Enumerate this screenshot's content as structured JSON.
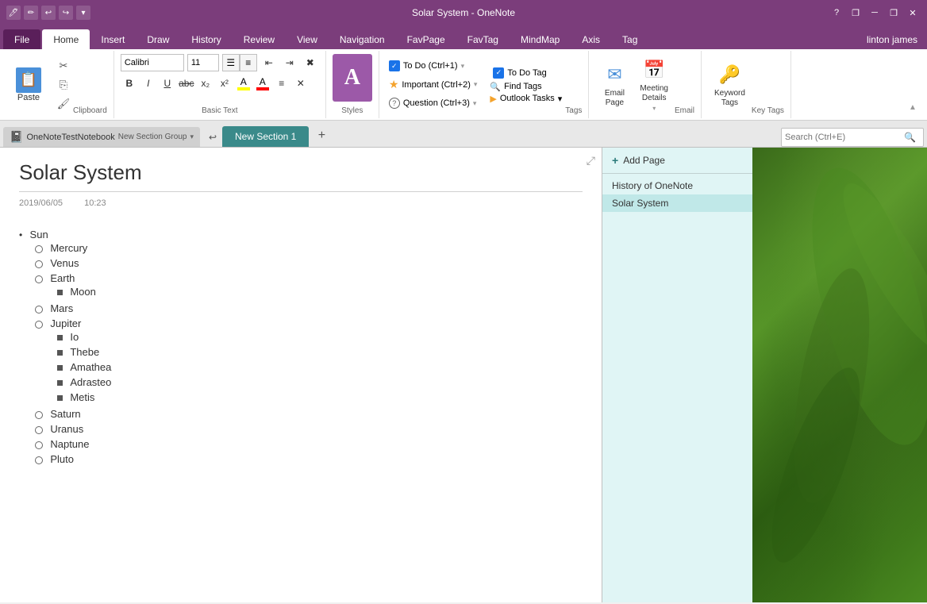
{
  "titlebar": {
    "title": "Solar System - OneNote",
    "help": "?",
    "restore": "❐",
    "minimize": "─",
    "maximize": "❐",
    "close": "✕"
  },
  "ribbon": {
    "tabs": [
      "File",
      "Home",
      "Insert",
      "Draw",
      "History",
      "Review",
      "View",
      "Navigation",
      "FavPage",
      "FavTag",
      "MindMap",
      "Axis",
      "Tag"
    ],
    "active_tab": "Home",
    "user": "linton james",
    "clipboard": {
      "paste": "Paste",
      "cut": "✂",
      "copy": "⎘",
      "format_painter": "🖌"
    },
    "basic_text": {
      "label": "Basic Text",
      "font": "Calibri",
      "size": "11",
      "bold": "B",
      "italic": "I",
      "underline": "U",
      "strikethrough": "ab̶c̶",
      "subscript": "x₂",
      "superscript": "x²"
    },
    "styles": {
      "label": "Styles",
      "icon": "A"
    },
    "tags": {
      "label": "Tags",
      "todo": "To Do (Ctrl+1)",
      "important": "Important (Ctrl+2)",
      "question": "Question (Ctrl+3)",
      "todo_tag": "To Do Tag",
      "find_tags": "Find Tags",
      "outlook_tasks": "Outlook Tasks"
    },
    "email": {
      "label": "Email",
      "email_page": "Email\nPage",
      "meeting_details": "Meeting\nDetails",
      "keyword_tags": "Keyword\nTags"
    }
  },
  "section_bar": {
    "notebook": "OneNoteTestNotebook",
    "section_group": "New Section Group",
    "section": "New Section 1",
    "search_placeholder": "Search (Ctrl+E)"
  },
  "note": {
    "title": "Solar System",
    "date": "2019/06/05",
    "time": "10:23",
    "content": {
      "sun": "Sun",
      "planets": [
        {
          "name": "Mercury",
          "moons": []
        },
        {
          "name": "Venus",
          "moons": []
        },
        {
          "name": "Earth",
          "moons": [
            "Moon"
          ]
        },
        {
          "name": "Mars",
          "moons": []
        },
        {
          "name": "Jupiter",
          "moons": [
            "Io",
            "Thebe",
            "Amathea",
            "Adrasteo",
            "Metis"
          ]
        },
        {
          "name": "Saturn",
          "moons": []
        },
        {
          "name": "Uranus",
          "moons": []
        },
        {
          "name": "Naptune",
          "moons": []
        },
        {
          "name": "Pluto",
          "moons": []
        }
      ]
    }
  },
  "right_panel": {
    "add_page": "Add Page",
    "history_label": "History of OneNote",
    "pages": [
      "Solar System"
    ]
  },
  "icons": {
    "notebook": "📓",
    "paste": "📋",
    "search": "🔍",
    "email": "✉",
    "meeting": "📅",
    "keyword": "🔑",
    "expand": "⤢",
    "plus": "+",
    "undo": "↩",
    "dropdown": "▾",
    "check": "✓",
    "star": "★",
    "question": "?",
    "outlook_arrow": "▶"
  }
}
